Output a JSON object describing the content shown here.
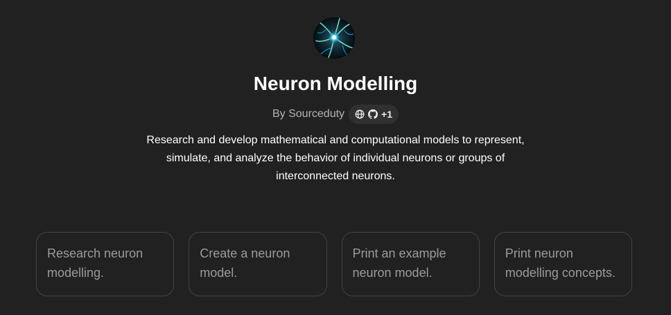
{
  "gpt": {
    "avatar_icon": "neuron-avatar-icon",
    "title": "Neuron Modelling",
    "author": "By Sourceduty",
    "link_icons": [
      "globe-icon",
      "github-icon"
    ],
    "extra_links": "+1",
    "description": "Research and develop mathematical and computational models to represent, simulate, and analyze the behavior of individual neurons or groups of interconnected neurons."
  },
  "starters": [
    {
      "label": "Research neuron modelling."
    },
    {
      "label": "Create a neuron model."
    },
    {
      "label": "Print an example neuron model."
    },
    {
      "label": "Print neuron modelling concepts."
    }
  ],
  "colors": {
    "background": "#212121",
    "card_border": "#444444",
    "pill_background": "#303030"
  }
}
